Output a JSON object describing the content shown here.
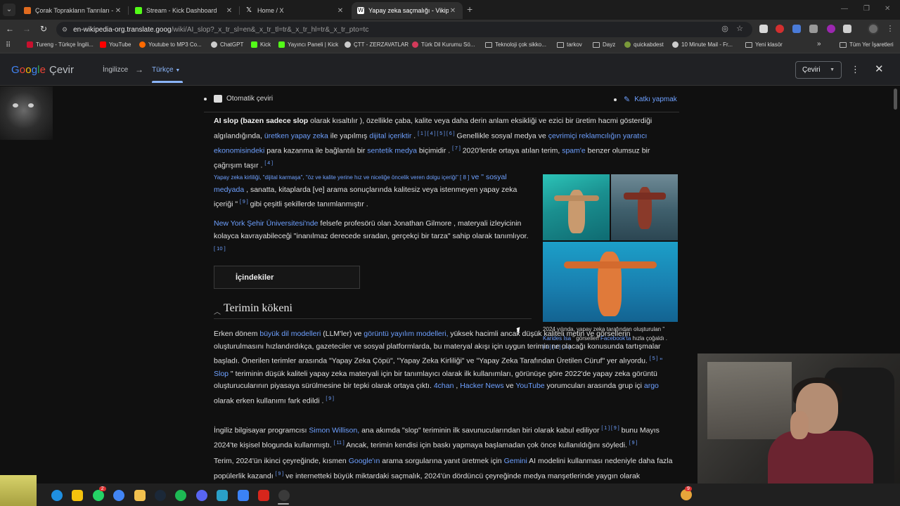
{
  "tabs": [
    {
      "title": "Çorak Toprakların Tanrıları - ZEZ",
      "icon": "game-icon",
      "color": "#e06b1f"
    },
    {
      "title": "Stream - Kick Dashboard",
      "icon": "kick-icon",
      "color": "#53fc18"
    },
    {
      "title": "Home / X",
      "icon": "x-icon",
      "color": "#ffffff"
    },
    {
      "title": "Yapay zeka saçmalığı - Vikipedi",
      "icon": "wikipedia-icon",
      "color": "#ffffff"
    }
  ],
  "omnibox": {
    "host": "en-wikipedia-org.translate.goog",
    "path": "/wiki/AI_slop?_x_tr_sl=en&_x_tr_tl=tr&_x_tr_hl=tr&_x_tr_pto=tc"
  },
  "bookmarks": [
    {
      "label": "Tureng - Türkçe İngili...",
      "icon": "tureng-icon",
      "color": "#c8102e"
    },
    {
      "label": "YouTube",
      "icon": "youtube-icon",
      "color": "#ff0000"
    },
    {
      "label": "Youtube to MP3 Co...",
      "icon": "mp3-icon",
      "color": "#ff6a00"
    },
    {
      "label": "ChatGPT",
      "icon": "chatgpt-icon",
      "color": "#cccccc"
    },
    {
      "label": "Kick",
      "icon": "kick-icon",
      "color": "#53fc18"
    },
    {
      "label": "Yayıncı Paneli | Kick",
      "icon": "kick-icon",
      "color": "#53fc18"
    },
    {
      "label": "ÇTT - ZERZAVATLAR",
      "icon": "globe-icon",
      "color": "#cccccc"
    },
    {
      "label": "Türk Dil Kurumu Sö...",
      "icon": "tdk-icon",
      "color": "#d33a5a"
    },
    {
      "label": "Teknoloji çok sikko...",
      "icon": "folder-icon",
      "color": "#bbbbbb"
    },
    {
      "label": "tarkov",
      "icon": "folder-icon",
      "color": "#bbbbbb"
    },
    {
      "label": "Dayz",
      "icon": "folder-icon",
      "color": "#bbbbbb"
    },
    {
      "label": "quickabdest",
      "icon": "quickabdest-icon",
      "color": "#7a9a3a"
    },
    {
      "label": "10 Minute Mail - Fr...",
      "icon": "mail-icon",
      "color": "#cccccc"
    },
    {
      "label": "Yeni klasör",
      "icon": "folder-icon",
      "color": "#bbbbbb"
    }
  ],
  "bookmarks_more": "»",
  "bookmarks_all": "Tüm Yer İşaretleri",
  "translate": {
    "logo_google": [
      "G",
      "o",
      "o",
      "g",
      "l",
      "e"
    ],
    "logo_colors": [
      "#4285f4",
      "#ea4335",
      "#fbbc05",
      "#4285f4",
      "#34a853",
      "#ea4335"
    ],
    "product": "Çevir",
    "source_lang": "İngilizce",
    "arrow": "→",
    "target_lang": "Türkçe",
    "menu_button": "Çeviri"
  },
  "article": {
    "auto_translate": "Otomatik çeviri",
    "contribute": "Katkı yapmak",
    "p1": {
      "bold": "AI slop (bazen sadece slop",
      "t1": " olarak kısaltılır ), özellikle çaba, kalite veya daha derin anlam eksikliği ve ezici bir üretim hacmi gösterdiği algılandığında, ",
      "l1": "üretken yapay zeka",
      "t2": " ile yapılmış ",
      "l2": "dijital içeriktir",
      "t3": " . ",
      "refs1": "[ 1 ] [ 4 ] [ 5 ] [ 6 ]",
      "t4": " Genellikle sosyal medya ve ",
      "l3": "çevrimiçi reklamcılığın yaratıcı ekonomisindeki",
      "t5": " para kazanma ile bağlantılı bir ",
      "l4": "sentetik medya",
      "t6": " biçimidir . ",
      "refs2": "[ 7 ]",
      "t7": " 2020'lerde ortaya atılan terim, ",
      "l5": "spam'e",
      "t8": " benzer olumsuz bir çağrışım taşır . ",
      "refs3": "[ 4 ]"
    },
    "p2": {
      "small": "Yapay zeka kirliliği, \"dijital karmaşa\", \"öz ve kalite yerine hız ve niceliğe öncelik veren dolgu içeriği\" [ 8 ]",
      "l1": " ve \" sosyal medyada",
      "t1": " , sanatta, kitaplarda [ve] arama sonuçlarında kalitesiz veya istenmeyen yapay zeka içeriği \" ",
      "refs1": "[ 9 ]",
      "t2": " gibi çeşitli şekillerde tanımlanmıştır ."
    },
    "p3": {
      "l1": "New York Şehir Üniversitesi'nde",
      "t1": " felsefe profesörü olan Jonathan Gilmore , materyali izleyicinin kolayca kavrayabileceği \"inanılmaz derecede sıradan, gerçekçi bir tarza\" sahip olarak tanımlıyor.",
      "refs1": "[ 10 ]"
    },
    "toc": "İçindekiler",
    "h2": "Terimin kökeni",
    "p4": {
      "t1": "Erken dönem ",
      "l1": "büyük dil modelleri",
      "t2": " (LLM'ler) ve ",
      "l2": "görüntü yayılım modelleri,",
      "t3": " yüksek hacimli ancak düşük kaliteli metin ve görsellerin oluşturulmasını hızlandırdıkça, gazeteciler ve sosyal platformlarda, bu materyal akışı için uygun terimin ne olacağı konusunda tartışmalar başladı. Önerilen terimler arasında \"Yapay Zeka Çöpü\", \"Yapay Zeka Kirliliği\" ve \"Yapay Zeka Tarafından Üretilen Cüruf\" yer alıyordu. ",
      "refs1": "[ 5 ]",
      "l3": " \" Slop",
      "t4": " \" teriminin düşük kaliteli yapay zeka materyali için bir tanımlayıcı olarak ilk kullanımları, görünüşe göre 2022'de yapay zeka görüntü oluşturucularının piyasaya sürülmesine bir tepki olarak ortaya çıktı. ",
      "l4": "4chan",
      "t5": " , ",
      "l5": "Hacker News",
      "t6": " ve ",
      "l6": "YouTube",
      "t7": " yorumcuları arasında grup içi ",
      "l7": "argo",
      "t8": " olarak erken kullanımı fark edildi . ",
      "refs2": "[ 9 ]"
    },
    "p5": {
      "t1": "İngiliz bilgisayar programcısı ",
      "l1": "Simon Willison,",
      "t2": " ana akımda \"slop\" teriminin ilk savunucularından biri olarak kabul ediliyor ",
      "refs1": "[ 1 ] [ 9 ]",
      "t3": " bunu Mayıs 2024'te kişisel blogunda kullanmıştı. ",
      "refs2": "[ 11 ]",
      "t4": " Ancak, terimin kendisi için baskı yapmaya başlamadan çok önce kullanıldığını söyledi. ",
      "refs3": "[ 9 ]"
    },
    "p6": {
      "t1": "Terim, 2024'ün ikinci çeyreğinde, kısmen ",
      "l1": "Google'ın",
      "t2": " arama sorgularına yanıt üretmek için ",
      "l2": "Gemini",
      "t3": " AI modelini kullanması nedeniyle daha fazla popülerlik kazandı ",
      "refs1": "[ 9 ]",
      "t4": " ve internetteki büyük miktardaki saçmalık, 2024'ün dördüncü çeyreğinde medya manşetlerinde yaygın olarak"
    },
    "figure_caption": {
      "t1": "2024 yılında, yapay zeka tarafından oluşturulan \" ",
      "l1": "Karides İsa",
      "t2": " \" görselleri ",
      "l2": "Facebook'ta",
      "t3": " hızla çoğaldı . ",
      "refs": "[ 1 ] [ 2 ] [ 3 ]"
    }
  },
  "taskbar": {
    "icons": [
      {
        "name": "edge-icon",
        "color": "#1f8fe0"
      },
      {
        "name": "notes-icon",
        "color": "#f4c20d"
      },
      {
        "name": "whatsapp-icon",
        "color": "#25d366",
        "badge": "2"
      },
      {
        "name": "chrome-icon",
        "color": "#4285f4"
      },
      {
        "name": "file-explorer-icon",
        "color": "#f2c14e"
      },
      {
        "name": "steam-icon",
        "color": "#1b2838"
      },
      {
        "name": "spotify-icon",
        "color": "#1db954"
      },
      {
        "name": "discord-icon",
        "color": "#5865f2"
      },
      {
        "name": "app-icon",
        "color": "#2aa0c8"
      },
      {
        "name": "messenger-icon",
        "color": "#3b82f6"
      },
      {
        "name": "acrobat-icon",
        "color": "#d6261c"
      },
      {
        "name": "obs-icon",
        "color": "#3a3a3a"
      }
    ],
    "tray_badge": "9"
  }
}
